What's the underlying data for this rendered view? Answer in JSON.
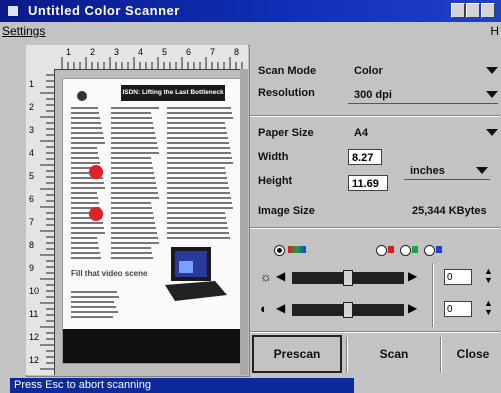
{
  "window": {
    "title": "Untitled Color Scanner"
  },
  "menu": {
    "settings": "Settings",
    "help": "H"
  },
  "ruler": {
    "top_numbers": [
      "1",
      "2",
      "3",
      "4",
      "5",
      "6",
      "7",
      "8"
    ],
    "left_numbers": [
      "1",
      "2",
      "3",
      "4",
      "5",
      "6",
      "7",
      "8",
      "9",
      "10",
      "11",
      "12",
      "12"
    ]
  },
  "preview": {
    "headline": "ISDN: Lifting the Last Bottleneck",
    "caption": "Fill that video scene"
  },
  "scan_mode": {
    "label": "Scan Mode",
    "value": "Color"
  },
  "resolution": {
    "label": "Resolution",
    "value": "300 dpi"
  },
  "paper_size": {
    "label": "Paper Size",
    "value": "A4"
  },
  "width": {
    "label": "Width",
    "value": "8.27"
  },
  "height": {
    "label": "Height",
    "value": "11.69"
  },
  "units": {
    "value": "inches"
  },
  "image_size": {
    "label": "Image Size",
    "value": "25,344 KBytes"
  },
  "adjust": {
    "brightness_value": "0",
    "contrast_value": "0",
    "brightness_level": 0.5,
    "contrast_level": 0.5
  },
  "buttons": {
    "prescan": "Prescan",
    "scan": "Scan",
    "close": "Close"
  },
  "status": {
    "text": "Press Esc to abort scanning"
  },
  "colors": {
    "titlebar": "#1030b8",
    "status_bg": "#0e2a9a",
    "accent_red": "#e0202a"
  }
}
